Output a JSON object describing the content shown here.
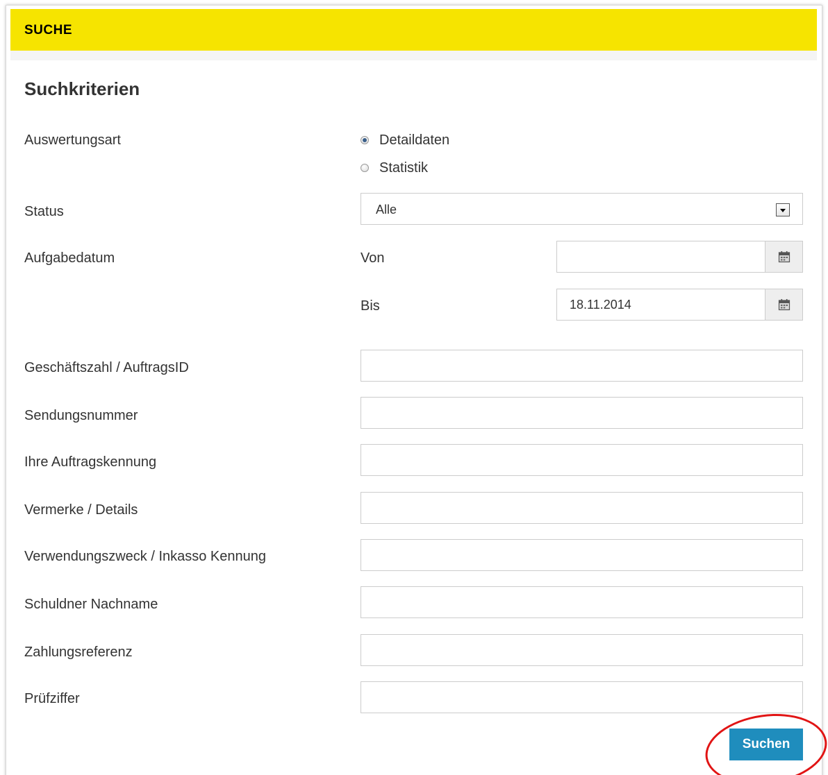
{
  "header": {
    "title": "SUCHE"
  },
  "form": {
    "title": "Suchkriterien",
    "auswertungsart": {
      "label": "Auswertungsart",
      "options": [
        {
          "label": "Detaildaten",
          "checked": true
        },
        {
          "label": "Statistik",
          "checked": false
        }
      ]
    },
    "status": {
      "label": "Status",
      "value": "Alle"
    },
    "aufgabedatum": {
      "label": "Aufgabedatum",
      "von_label": "Von",
      "von_value": "",
      "bis_label": "Bis",
      "bis_value": "18.11.2014"
    },
    "fields": [
      {
        "label": "Geschäftszahl / AuftragsID",
        "value": ""
      },
      {
        "label": "Sendungsnummer",
        "value": ""
      },
      {
        "label": "Ihre Auftragskennung",
        "value": ""
      },
      {
        "label": "Vermerke / Details",
        "value": ""
      },
      {
        "label": "Verwendungszweck / Inkasso Kennung",
        "value": ""
      },
      {
        "label": "Schuldner Nachname",
        "value": ""
      },
      {
        "label": "Zahlungsreferenz",
        "value": ""
      },
      {
        "label": "Prüfziffer",
        "value": ""
      }
    ],
    "submit_label": "Suchen"
  },
  "colors": {
    "header_bg": "#f6e400",
    "button_bg": "#1f8dbd",
    "highlight": "#e11414"
  },
  "icons": [
    "calendar-icon",
    "calendar-icon",
    "chevron-down-icon"
  ]
}
